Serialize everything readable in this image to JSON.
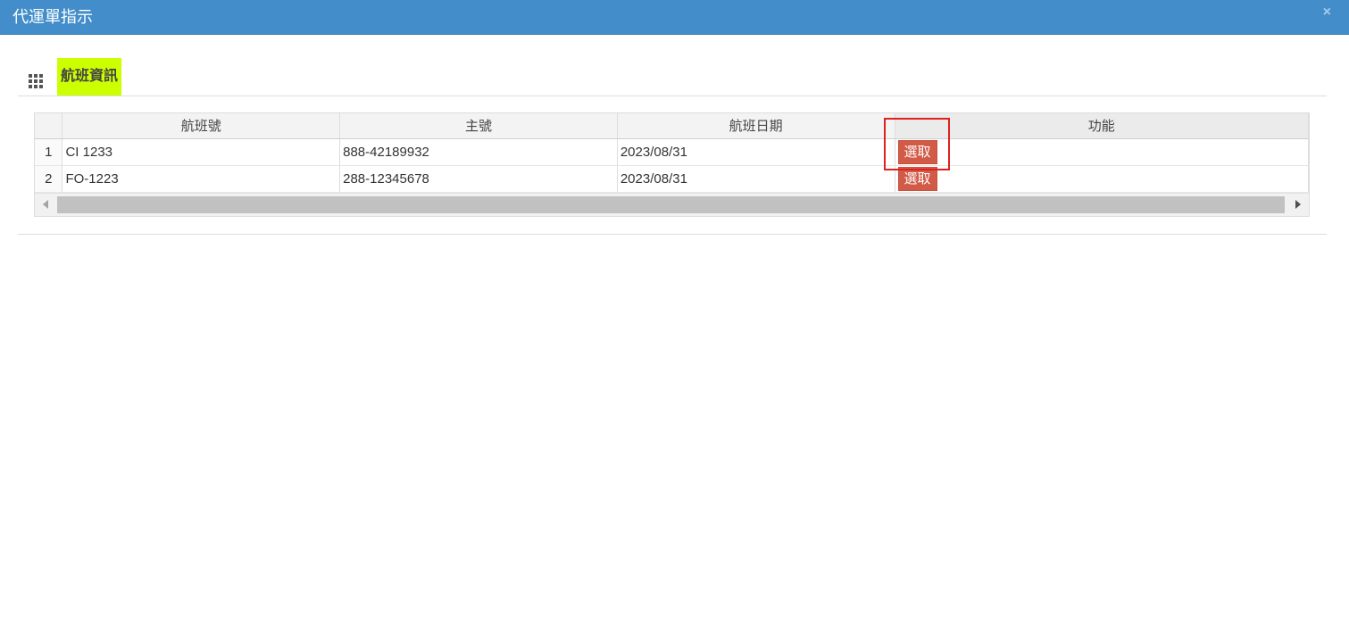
{
  "window": {
    "title": "代運單指示",
    "close_symbol": "×"
  },
  "section": {
    "icon": "grid-icon",
    "title": "航班資訊"
  },
  "table": {
    "columns": [
      "航班號",
      "主號",
      "航班日期",
      "功能"
    ],
    "rows": [
      {
        "row_num": "1",
        "flight_no": "CI 1233",
        "master_no": "888-42189932",
        "flight_date": "2023/08/31",
        "action_label": "選取"
      },
      {
        "row_num": "2",
        "flight_no": "FO-1223",
        "master_no": "288-12345678",
        "flight_date": "2023/08/31",
        "action_label": "選取"
      }
    ]
  },
  "colors": {
    "titlebar": "#438eca",
    "section_highlight": "#ccff00",
    "action_button": "#d15b47",
    "annotation_box": "#e0201f"
  }
}
